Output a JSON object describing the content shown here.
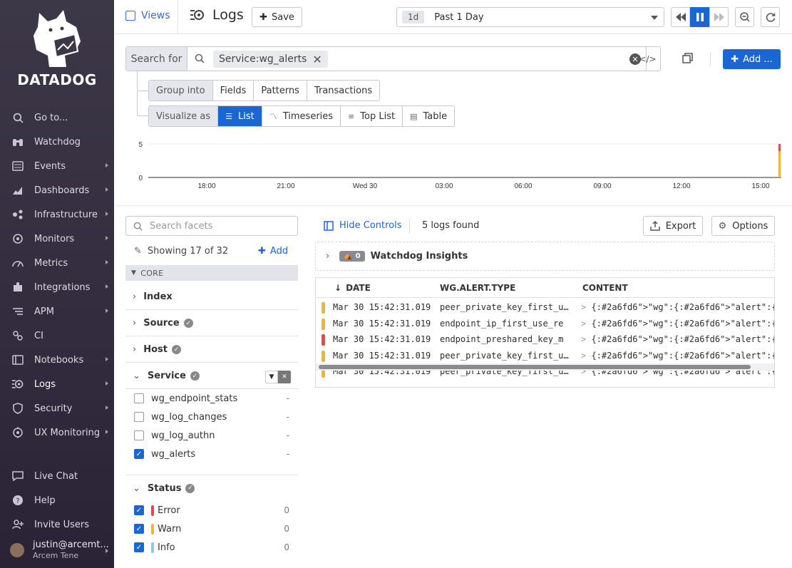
{
  "brand": {
    "name": "DATADOG"
  },
  "sidebar": {
    "items": [
      {
        "label": "Go to...",
        "icon": "search-icon",
        "arrow": false
      },
      {
        "label": "Watchdog",
        "icon": "binoculars-icon",
        "arrow": false
      },
      {
        "label": "Events",
        "icon": "events-icon",
        "arrow": true
      },
      {
        "label": "Dashboards",
        "icon": "dashboards-icon",
        "arrow": true
      },
      {
        "label": "Infrastructure",
        "icon": "infrastructure-icon",
        "arrow": true
      },
      {
        "label": "Monitors",
        "icon": "monitors-icon",
        "arrow": true
      },
      {
        "label": "Metrics",
        "icon": "metrics-icon",
        "arrow": true
      },
      {
        "label": "Integrations",
        "icon": "puzzle-icon",
        "arrow": true
      },
      {
        "label": "APM",
        "icon": "apm-icon",
        "arrow": true
      },
      {
        "label": "CI",
        "icon": "ci-icon",
        "arrow": false
      },
      {
        "label": "Notebooks",
        "icon": "notebook-icon",
        "arrow": true
      },
      {
        "label": "Logs",
        "icon": "logs-icon",
        "arrow": true,
        "active": true
      },
      {
        "label": "Security",
        "icon": "shield-icon",
        "arrow": true
      },
      {
        "label": "UX Monitoring",
        "icon": "ux-monitoring-icon",
        "arrow": true
      }
    ],
    "bottom_items": [
      {
        "label": "Live Chat",
        "icon": "chat-icon"
      },
      {
        "label": "Help",
        "icon": "help-icon"
      },
      {
        "label": "Invite Users",
        "icon": "users-icon"
      }
    ],
    "user": {
      "name": "justin@arcemt...",
      "org": "Arcem Tene"
    }
  },
  "topbar": {
    "views_label": "Views",
    "title": "Logs",
    "save_label": "Save",
    "time_tag": "1d",
    "time_label": "Past 1 Day"
  },
  "search": {
    "prefix": "Search for",
    "pill": "Service:wg_alerts",
    "add_label": "Add ..."
  },
  "group_into": {
    "head": "Group into",
    "options": [
      "Fields",
      "Patterns",
      "Transactions"
    ]
  },
  "visualize_as": {
    "head": "Visualize as",
    "options": [
      "List",
      "Timeseries",
      "Top List",
      "Table"
    ],
    "selected": "List"
  },
  "chart_data": {
    "type": "bar",
    "yticks": [
      "5",
      "0"
    ],
    "xticks": [
      "18:00",
      "21:00",
      "Wed 30",
      "03:00",
      "06:00",
      "09:00",
      "12:00",
      "15:00"
    ],
    "ylim": [
      0,
      5
    ],
    "bar_at": "15:42",
    "bar_value": 5,
    "colors": {
      "warn": "#f2b33d",
      "error": "#e04b4b",
      "line": "#2c2c2c"
    }
  },
  "facets": {
    "search_placeholder": "Search facets",
    "showing": "Showing 17 of 32",
    "add_label": "Add",
    "section": "CORE",
    "groups": [
      {
        "label": "Index",
        "check": false,
        "open": false
      },
      {
        "label": "Source",
        "check": true,
        "open": false
      },
      {
        "label": "Host",
        "check": true,
        "open": false
      },
      {
        "label": "Service",
        "check": true,
        "open": true
      },
      {
        "label": "Status",
        "check": true,
        "open": true
      }
    ],
    "service_values": [
      {
        "label": "wg_endpoint_stats",
        "checked": false,
        "count": "-"
      },
      {
        "label": "wg_log_changes",
        "checked": false,
        "count": "-"
      },
      {
        "label": "wg_log_authn",
        "checked": false,
        "count": "-"
      },
      {
        "label": "wg_alerts",
        "checked": true,
        "count": "-"
      }
    ],
    "status_values": [
      {
        "label": "Error",
        "checked": true,
        "count": "0",
        "color": "#e04b4b"
      },
      {
        "label": "Warn",
        "checked": true,
        "count": "0",
        "color": "#f2b33d"
      },
      {
        "label": "Info",
        "checked": true,
        "count": "0",
        "color": "#8fc7ea"
      }
    ]
  },
  "logs": {
    "hide_controls": "Hide Controls",
    "found": "5 logs found",
    "export_label": "Export",
    "options_label": "Options",
    "insights_count": "0",
    "insights_label": "Watchdog Insights",
    "columns": [
      "DATE",
      "WG.ALERT.TYPE",
      "CONTENT"
    ],
    "rows": [
      {
        "status": "warn",
        "color": "#f2b33d",
        "date": "Mar 30 15:42:31.019",
        "type": "peer_private_key_first_use",
        "content": "{\"wg\":{\"alert\":{\"params\":{\"peer\":\"Jus"
      },
      {
        "status": "warn",
        "color": "#f2b33d",
        "date": "Mar 30 15:42:31.019",
        "type": "endpoint_ip_first_use_re",
        "content": "{\"wg\":{\"alert\":{\"params\":{\"peer\":\"Jus"
      },
      {
        "status": "error",
        "color": "#e04b4b",
        "date": "Mar 30 15:42:31.019",
        "type": "endpoint_preshared_key_m",
        "content": "{\"wg\":{\"alert\":{\"params\":{\"host\":\"Jus"
      },
      {
        "status": "warn",
        "color": "#f2b33d",
        "date": "Mar 30 15:42:31.019",
        "type": "peer_private_key_first_use",
        "content": "{\"wg\":{\"alert\":{\"params\":{\"peer\":\"VPN"
      },
      {
        "status": "warn",
        "color": "#f2b33d",
        "date": "Mar 30 15:42:31.019",
        "type": "peer_private_key_first_use",
        "content": "{\"wg\":{\"alert\":{\"params\":{\"peer\":\"Jus"
      }
    ]
  }
}
